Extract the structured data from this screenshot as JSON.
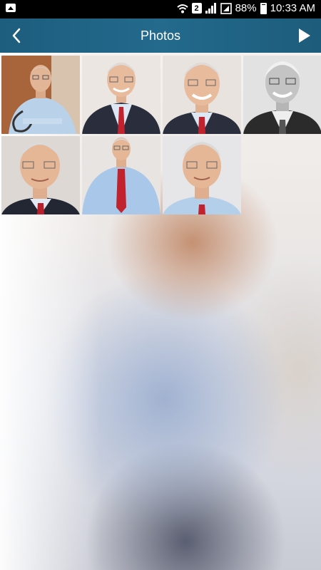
{
  "status_bar": {
    "sim_slot": "2",
    "battery_level": "88%",
    "time": "10:33 AM",
    "icons": [
      "gallery-icon",
      "wifi-icon",
      "signal-icon",
      "battery-icon"
    ]
  },
  "header": {
    "title": "Photos",
    "back_icon": "chevron-left-icon",
    "play_icon": "play-icon",
    "color": "#1f6283"
  },
  "photos": [
    {
      "name": "photo-1",
      "style": "color-doctor-stethoscope"
    },
    {
      "name": "photo-2",
      "style": "color-suit-red-tie"
    },
    {
      "name": "photo-3",
      "style": "color-suit-red-tie-closeup"
    },
    {
      "name": "photo-4",
      "style": "grayscale-suit"
    },
    {
      "name": "photo-5",
      "style": "color-suit-tilted"
    },
    {
      "name": "photo-6",
      "style": "color-blue-shirt-red-tie"
    },
    {
      "name": "photo-7",
      "style": "color-blue-shirt-closeup"
    }
  ]
}
